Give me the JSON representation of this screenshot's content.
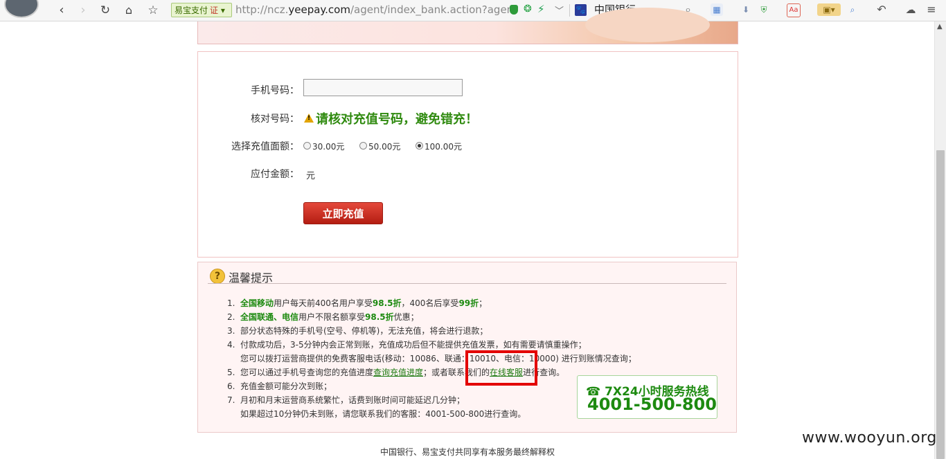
{
  "browser": {
    "pay_button_label": "易宝支付",
    "pay_button_badge": "证",
    "url_prefix": "http://ncz.",
    "url_domain": "yeepay.com",
    "url_path": "/agent/index_bank.action?agent",
    "search_term": "中国银行"
  },
  "form": {
    "phone_label": "手机号码：",
    "phone_value": "",
    "verify_label": "核对号码：",
    "verify_message": "请核对充值号码，避免错充！",
    "amount_label": "选择充值面额：",
    "amount_options": [
      "30.00元",
      "50.00元",
      "100.00元"
    ],
    "amount_selected": "100.00元",
    "payable_label": "应付金额：",
    "payable_unit": "元",
    "submit_label": "立即充值"
  },
  "tips": {
    "title": "温馨提示",
    "items": [
      {
        "num": "1.",
        "parts": [
          "全国移动",
          "用户每天前400名用户享受",
          "98.5折",
          "，400名后享受",
          "99折",
          "；"
        ]
      },
      {
        "num": "2.",
        "parts": [
          "全国联通、电信",
          "用户不限名额享受",
          "98.5折",
          "优惠；"
        ]
      },
      {
        "num": "3.",
        "text": "部分状态特殊的手机号(空号、停机等)，无法充值，将会进行退款；"
      },
      {
        "num": "4.",
        "text": "付款成功后，3-5分钟内会正常到账，充值成功后但不能提供充值发票，如有需要请慎重操作；",
        "cont": "您可以拨打运营商提供的免费客服电话(移动：10086、联通：10010、电信：10000) 进行到账情况查询；"
      },
      {
        "num": "5.",
        "parts": [
          "您可以通过手机号查询您的充值进度",
          "查询充值进度",
          "；或者联系我们的",
          "在线客服",
          "进行查询。"
        ]
      },
      {
        "num": "6.",
        "text": "充值金额可能分次到账；"
      },
      {
        "num": "7.",
        "text": "月初和月末运营商系统繁忙，话费到账时间可能延迟几分钟；",
        "cont": "如果超过10分钟仍未到账，请您联系我们的客服：4001-500-800进行查询。"
      }
    ]
  },
  "hotline": {
    "label": "☎ 7X24小时服务热线",
    "number": "4001-500-800"
  },
  "footer": "中国银行、易宝支付共同享有本服务最终解释权",
  "watermark": "www.wooyun.org",
  "colors": {
    "accent_green": "#1d8a10",
    "button_red": "#c52a1e",
    "highlight_box": "#e30000"
  }
}
